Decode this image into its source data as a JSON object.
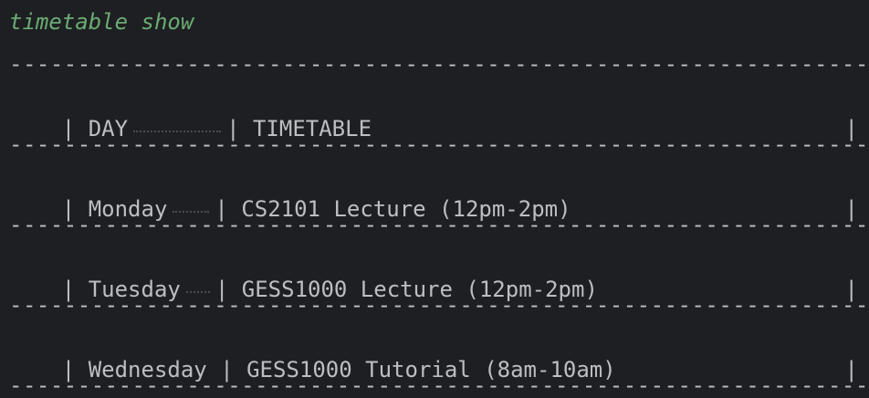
{
  "command": "timetable show",
  "separator": "--------------------------------------------------------------------------------",
  "pipe": "|",
  "header": {
    "day": "DAY",
    "timetable": "TIMETABLE"
  },
  "rows": [
    {
      "day": "Monday",
      "timetable": "CS2101 Lecture (12pm-2pm)"
    },
    {
      "day": "Tuesday",
      "timetable": "GESS1000 Lecture (12pm-2pm)"
    },
    {
      "day": "Wednesday",
      "timetable": "GESS1000 Tutorial (8am-10am)"
    }
  ],
  "colors": {
    "background": "#1e1f22",
    "text": "#bcbec4",
    "command": "#6aab73"
  }
}
